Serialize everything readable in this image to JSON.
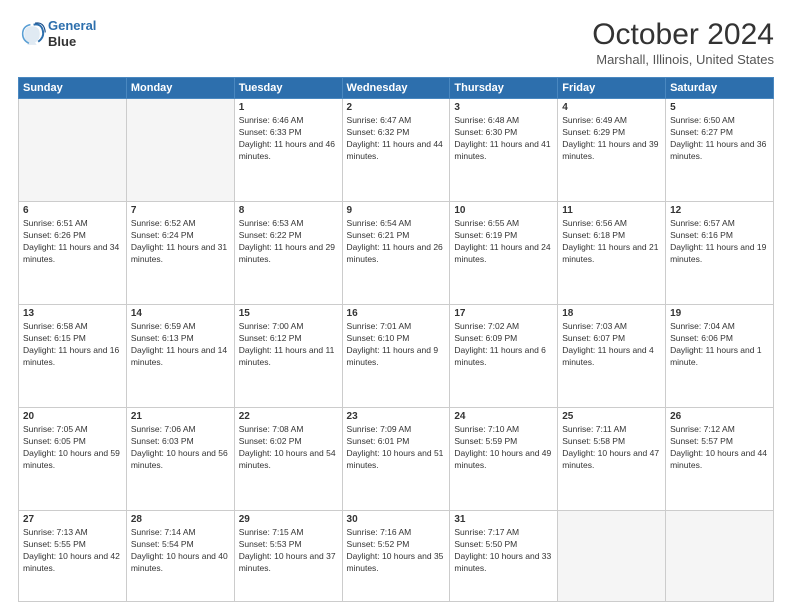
{
  "header": {
    "logo_line1": "General",
    "logo_line2": "Blue",
    "month": "October 2024",
    "location": "Marshall, Illinois, United States"
  },
  "days_of_week": [
    "Sunday",
    "Monday",
    "Tuesday",
    "Wednesday",
    "Thursday",
    "Friday",
    "Saturday"
  ],
  "weeks": [
    [
      {
        "day": "",
        "text": ""
      },
      {
        "day": "",
        "text": ""
      },
      {
        "day": "1",
        "text": "Sunrise: 6:46 AM\nSunset: 6:33 PM\nDaylight: 11 hours and 46 minutes."
      },
      {
        "day": "2",
        "text": "Sunrise: 6:47 AM\nSunset: 6:32 PM\nDaylight: 11 hours and 44 minutes."
      },
      {
        "day": "3",
        "text": "Sunrise: 6:48 AM\nSunset: 6:30 PM\nDaylight: 11 hours and 41 minutes."
      },
      {
        "day": "4",
        "text": "Sunrise: 6:49 AM\nSunset: 6:29 PM\nDaylight: 11 hours and 39 minutes."
      },
      {
        "day": "5",
        "text": "Sunrise: 6:50 AM\nSunset: 6:27 PM\nDaylight: 11 hours and 36 minutes."
      }
    ],
    [
      {
        "day": "6",
        "text": "Sunrise: 6:51 AM\nSunset: 6:26 PM\nDaylight: 11 hours and 34 minutes."
      },
      {
        "day": "7",
        "text": "Sunrise: 6:52 AM\nSunset: 6:24 PM\nDaylight: 11 hours and 31 minutes."
      },
      {
        "day": "8",
        "text": "Sunrise: 6:53 AM\nSunset: 6:22 PM\nDaylight: 11 hours and 29 minutes."
      },
      {
        "day": "9",
        "text": "Sunrise: 6:54 AM\nSunset: 6:21 PM\nDaylight: 11 hours and 26 minutes."
      },
      {
        "day": "10",
        "text": "Sunrise: 6:55 AM\nSunset: 6:19 PM\nDaylight: 11 hours and 24 minutes."
      },
      {
        "day": "11",
        "text": "Sunrise: 6:56 AM\nSunset: 6:18 PM\nDaylight: 11 hours and 21 minutes."
      },
      {
        "day": "12",
        "text": "Sunrise: 6:57 AM\nSunset: 6:16 PM\nDaylight: 11 hours and 19 minutes."
      }
    ],
    [
      {
        "day": "13",
        "text": "Sunrise: 6:58 AM\nSunset: 6:15 PM\nDaylight: 11 hours and 16 minutes."
      },
      {
        "day": "14",
        "text": "Sunrise: 6:59 AM\nSunset: 6:13 PM\nDaylight: 11 hours and 14 minutes."
      },
      {
        "day": "15",
        "text": "Sunrise: 7:00 AM\nSunset: 6:12 PM\nDaylight: 11 hours and 11 minutes."
      },
      {
        "day": "16",
        "text": "Sunrise: 7:01 AM\nSunset: 6:10 PM\nDaylight: 11 hours and 9 minutes."
      },
      {
        "day": "17",
        "text": "Sunrise: 7:02 AM\nSunset: 6:09 PM\nDaylight: 11 hours and 6 minutes."
      },
      {
        "day": "18",
        "text": "Sunrise: 7:03 AM\nSunset: 6:07 PM\nDaylight: 11 hours and 4 minutes."
      },
      {
        "day": "19",
        "text": "Sunrise: 7:04 AM\nSunset: 6:06 PM\nDaylight: 11 hours and 1 minute."
      }
    ],
    [
      {
        "day": "20",
        "text": "Sunrise: 7:05 AM\nSunset: 6:05 PM\nDaylight: 10 hours and 59 minutes."
      },
      {
        "day": "21",
        "text": "Sunrise: 7:06 AM\nSunset: 6:03 PM\nDaylight: 10 hours and 56 minutes."
      },
      {
        "day": "22",
        "text": "Sunrise: 7:08 AM\nSunset: 6:02 PM\nDaylight: 10 hours and 54 minutes."
      },
      {
        "day": "23",
        "text": "Sunrise: 7:09 AM\nSunset: 6:01 PM\nDaylight: 10 hours and 51 minutes."
      },
      {
        "day": "24",
        "text": "Sunrise: 7:10 AM\nSunset: 5:59 PM\nDaylight: 10 hours and 49 minutes."
      },
      {
        "day": "25",
        "text": "Sunrise: 7:11 AM\nSunset: 5:58 PM\nDaylight: 10 hours and 47 minutes."
      },
      {
        "day": "26",
        "text": "Sunrise: 7:12 AM\nSunset: 5:57 PM\nDaylight: 10 hours and 44 minutes."
      }
    ],
    [
      {
        "day": "27",
        "text": "Sunrise: 7:13 AM\nSunset: 5:55 PM\nDaylight: 10 hours and 42 minutes."
      },
      {
        "day": "28",
        "text": "Sunrise: 7:14 AM\nSunset: 5:54 PM\nDaylight: 10 hours and 40 minutes."
      },
      {
        "day": "29",
        "text": "Sunrise: 7:15 AM\nSunset: 5:53 PM\nDaylight: 10 hours and 37 minutes."
      },
      {
        "day": "30",
        "text": "Sunrise: 7:16 AM\nSunset: 5:52 PM\nDaylight: 10 hours and 35 minutes."
      },
      {
        "day": "31",
        "text": "Sunrise: 7:17 AM\nSunset: 5:50 PM\nDaylight: 10 hours and 33 minutes."
      },
      {
        "day": "",
        "text": ""
      },
      {
        "day": "",
        "text": ""
      }
    ]
  ]
}
